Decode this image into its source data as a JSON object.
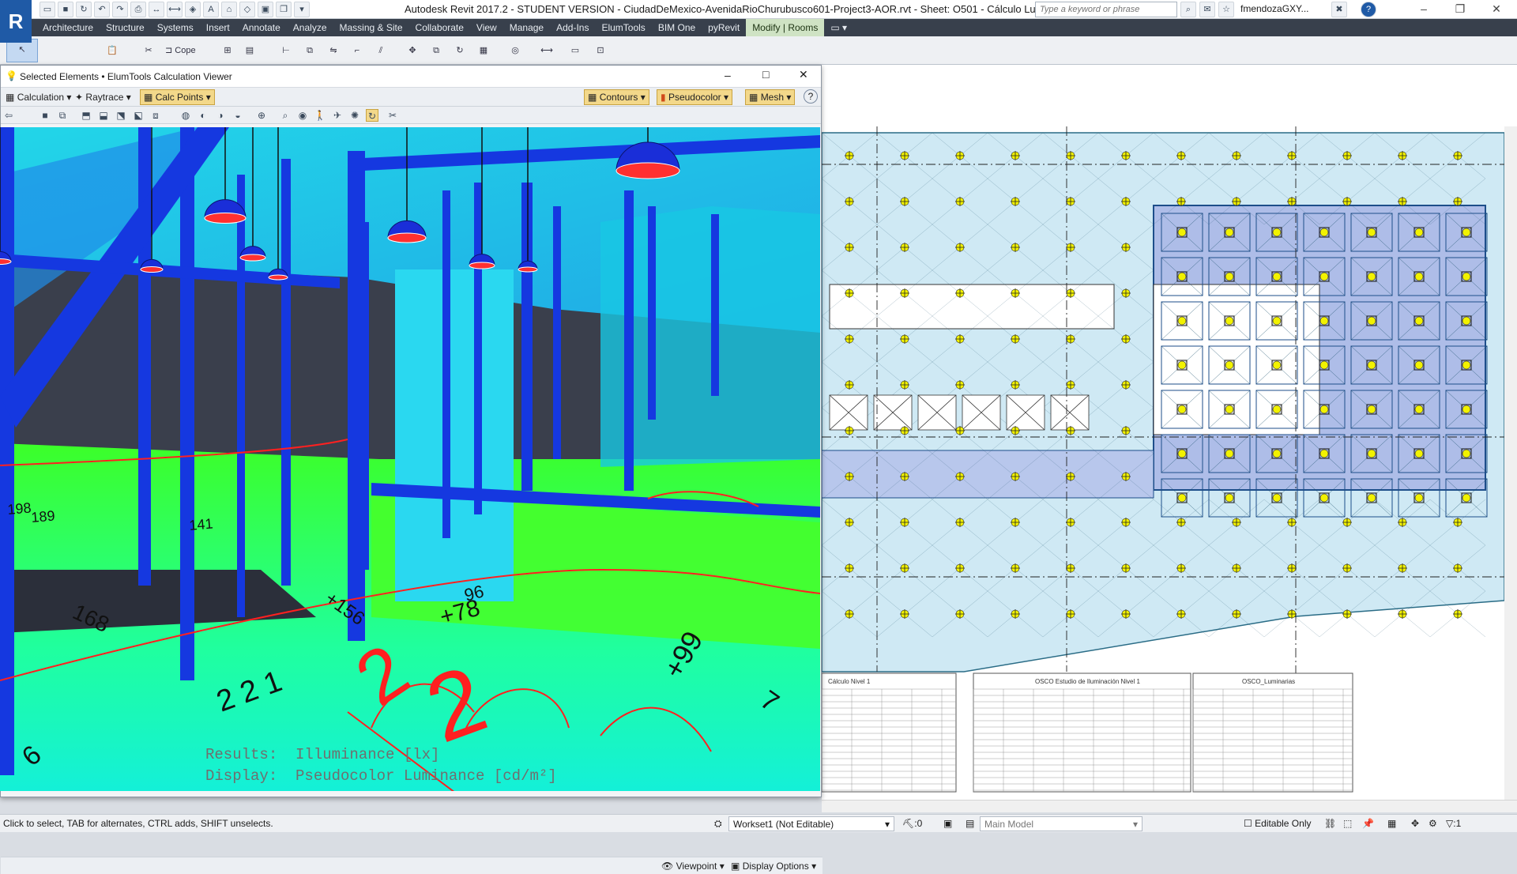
{
  "app": {
    "logo": "R",
    "title": "Autodesk Revit 2017.2 - STUDENT VERSION -    CiudadDeMexico-AvenidaRioChurubusco601-Project3-AOR.rvt - Sheet: O501 - Cálculo Lumínico",
    "search_placeholder": "Type a keyword or phrase",
    "user": "fmendozaGXY...",
    "minimize": "–",
    "maximize": "❐",
    "close": "✕",
    "help": "?"
  },
  "ribbon": {
    "tabs": [
      "Architecture",
      "Structure",
      "Systems",
      "Insert",
      "Annotate",
      "Analyze",
      "Massing & Site",
      "Collaborate",
      "View",
      "Manage",
      "Add-Ins",
      "ElumTools",
      "BIM One",
      "pyRevit",
      "Modify | Rooms"
    ],
    "active_tab": "Modify | Rooms",
    "cope_label": "Cope"
  },
  "calc_window": {
    "title": "Selected Elements • ElumTools Calculation Viewer",
    "toolbar": {
      "calculation": "Calculation",
      "raytrace": "Raytrace",
      "calc_points": "Calc Points",
      "contours": "Contours",
      "pseudocolor": "Pseudocolor",
      "mesh": "Mesh",
      "help": "?"
    },
    "overlay": {
      "line1": "Results:  Illuminance [lx]",
      "line2": "Display:  Pseudocolor Luminance [cd/m²]"
    },
    "floor_values": [
      "2",
      "2",
      "2 2 1",
      "+78",
      "+99",
      "96",
      "168",
      "+156",
      "141",
      "189",
      "198",
      "7",
      "6"
    ],
    "bottom": {
      "viewpoint": "Viewpoint",
      "display_options": "Display Options"
    }
  },
  "sheet": {
    "table_titles": [
      "Cálculo Nivel 1",
      "OSCO Estudio de Iluminación Nivel 1",
      "OSCO_Luminarias"
    ]
  },
  "status": {
    "hint": "Click to select, TAB for alternates, CTRL adds, SHIFT unselects.",
    "workset": "Workset1 (Not Editable)",
    "count": ":0",
    "design_option": "Main Model",
    "editable_only": "Editable Only",
    "filter_count": ":1"
  },
  "colors": {
    "ribbon_dark": "#38404c",
    "active_tab": "#cfe3c4",
    "structure_blue": "#1538e0",
    "floor_green": "#2cff2c",
    "contour_red": "#ff2020",
    "plan_fill": "#cfe9f4",
    "plan_corridor": "#aebde8"
  }
}
